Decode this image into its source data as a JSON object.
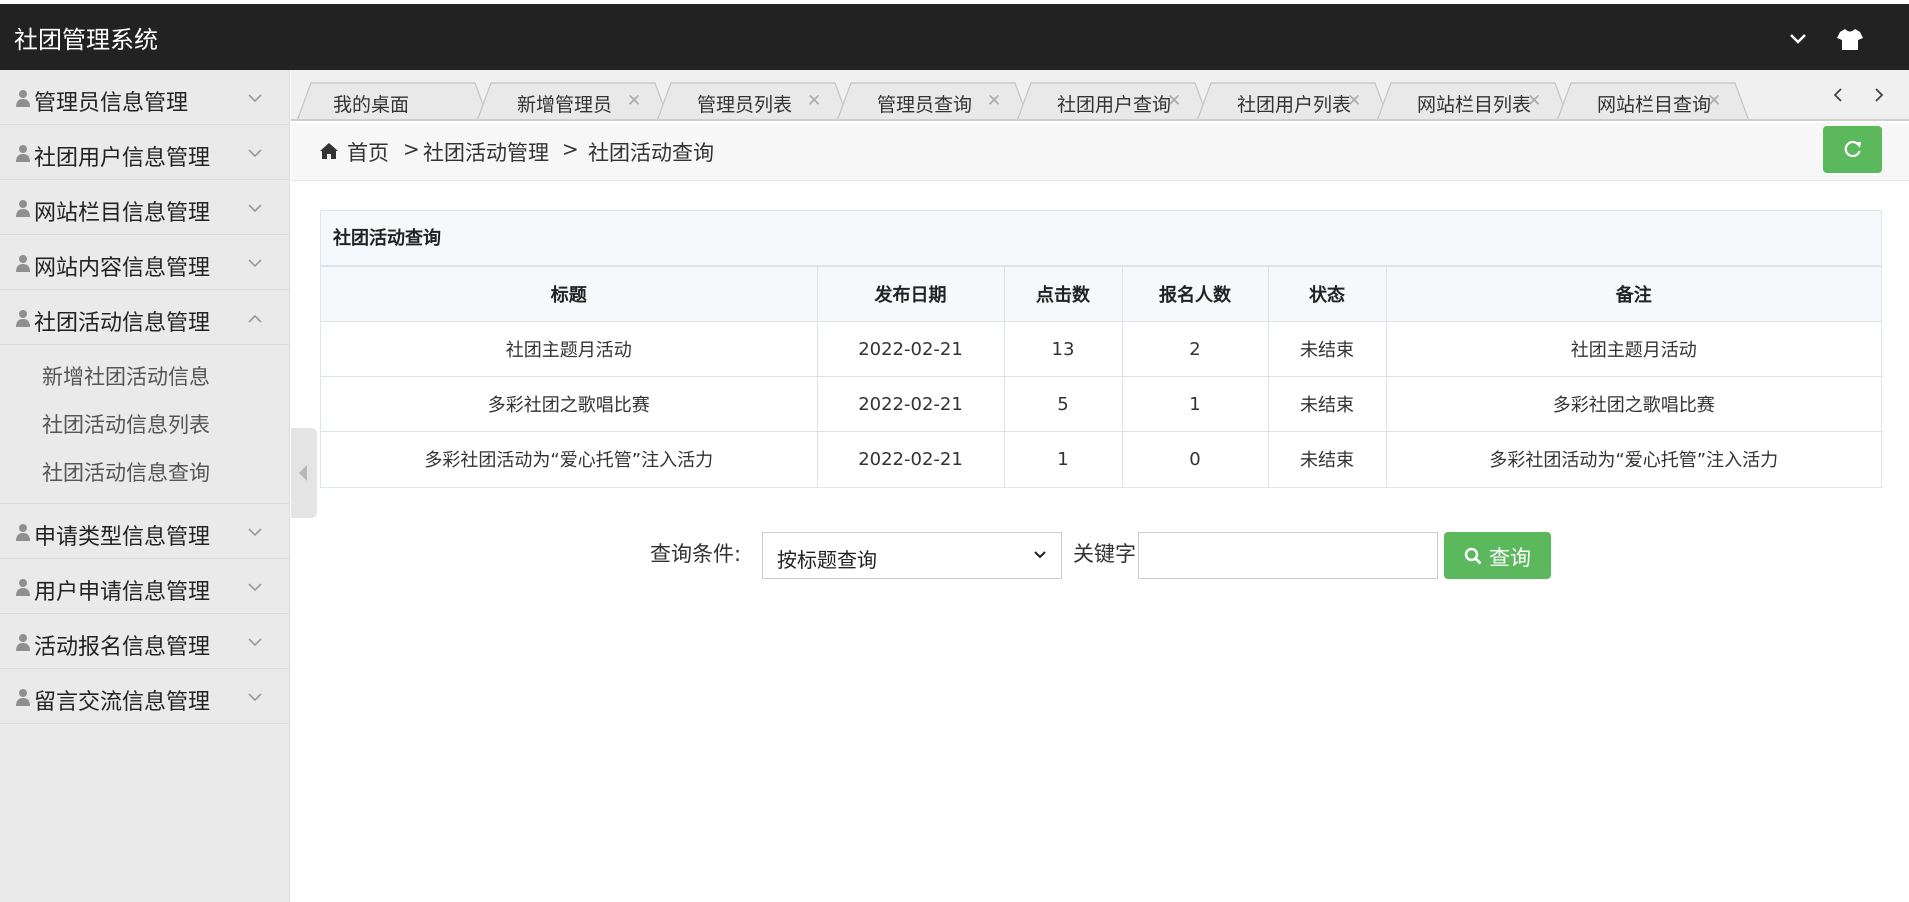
{
  "app": {
    "title": "社团管理系统"
  },
  "sidebar": {
    "items": [
      {
        "label": "管理员信息管理"
      },
      {
        "label": "社团用户信息管理"
      },
      {
        "label": "网站栏目信息管理"
      },
      {
        "label": "网站内容信息管理"
      },
      {
        "label": "社团活动信息管理",
        "expanded": true,
        "children": [
          "新增社团活动信息",
          "社团活动信息列表",
          "社团活动信息查询"
        ]
      },
      {
        "label": "申请类型信息管理"
      },
      {
        "label": "用户申请信息管理"
      },
      {
        "label": "活动报名信息管理"
      },
      {
        "label": "留言交流信息管理"
      }
    ]
  },
  "tabs": [
    {
      "label": "我的桌面",
      "closable": false
    },
    {
      "label": "新增管理员",
      "closable": true
    },
    {
      "label": "管理员列表",
      "closable": true
    },
    {
      "label": "管理员查询",
      "closable": true
    },
    {
      "label": "社团用户查询",
      "closable": true
    },
    {
      "label": "社团用户列表",
      "closable": true
    },
    {
      "label": "网站栏目列表",
      "closable": true
    },
    {
      "label": "网站栏目查询",
      "closable": true
    }
  ],
  "breadcrumb": {
    "home": "首页",
    "sep": ">",
    "level1": "社团活动管理",
    "level2": "社团活动查询"
  },
  "panel": {
    "title": "社团活动查询",
    "columns": [
      "标题",
      "发布日期",
      "点击数",
      "报名人数",
      "状态",
      "备注"
    ],
    "rows": [
      [
        "社团主题月活动",
        "2022-02-21",
        "13",
        "2",
        "未结束",
        "社团主题月活动"
      ],
      [
        "多彩社团之歌唱比赛",
        "2022-02-21",
        "5",
        "1",
        "未结束",
        "多彩社团之歌唱比赛"
      ],
      [
        "多彩社团活动为“爱心托管”注入活力",
        "2022-02-21",
        "1",
        "0",
        "未结束",
        "多彩社团活动为“爱心托管”注入活力"
      ]
    ]
  },
  "search": {
    "condition_label": "查询条件:",
    "condition_value": "按标题查询",
    "keyword_label": "关键字",
    "keyword_value": "",
    "button_label": "查询"
  },
  "colors": {
    "topbar": "#222222",
    "accent_green": "#5cb85c",
    "sidebar_bg": "#eaeaea"
  },
  "icons": [
    "chevron-down-icon",
    "tshirt-icon",
    "user-icon",
    "home-icon",
    "refresh-icon",
    "search-icon",
    "tab-close-icon"
  ]
}
